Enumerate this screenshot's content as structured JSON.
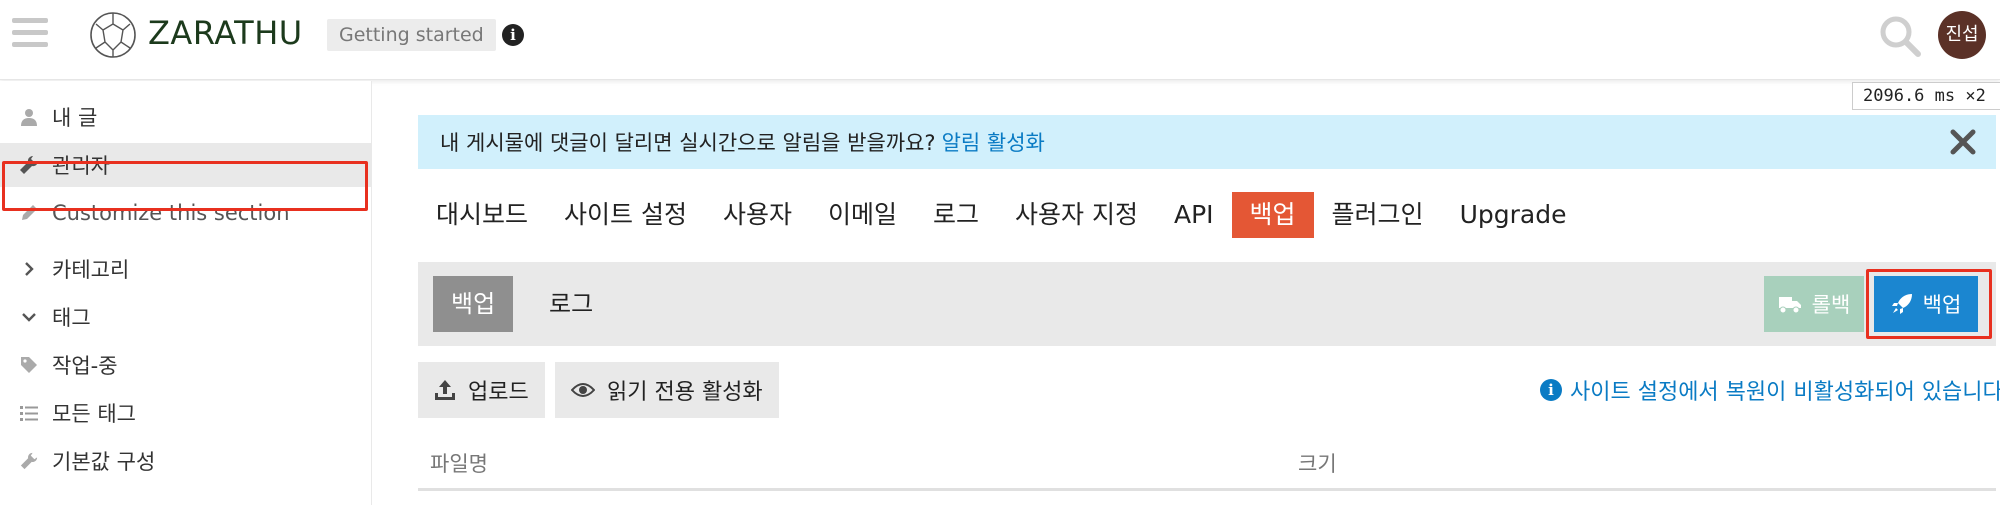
{
  "header": {
    "brand": "ZARATHU",
    "breadcrumb": "Getting started",
    "info_glyph": "i",
    "avatar_text": "진섭",
    "icons": [
      "hamburger-icon",
      "logo-icon",
      "info-icon",
      "search-icon"
    ]
  },
  "sidebar": {
    "items": [
      {
        "label": "내 글",
        "icon": "user-icon"
      },
      {
        "label": "관리자",
        "icon": "wrench-icon"
      },
      {
        "label": "Customize this section",
        "icon": "pencil-icon"
      },
      {
        "label": "카테고리",
        "icon": "chevron-right-icon"
      },
      {
        "label": "태그",
        "icon": "chevron-down-icon"
      },
      {
        "label": "작업-중",
        "icon": "tag-icon"
      },
      {
        "label": "모든 태그",
        "icon": "list-icon"
      },
      {
        "label": "기본값 구성",
        "icon": "wrench-icon"
      }
    ]
  },
  "timing": {
    "value": "2096.6",
    "unit": "ms",
    "mult": "×2"
  },
  "banner": {
    "text": "내 게시물에 댓글이 달리면 실시간으로 알림을 받을까요?",
    "link": "알림 활성화"
  },
  "admin_nav": {
    "tabs": [
      "대시보드",
      "사이트 설정",
      "사용자",
      "이메일",
      "로그",
      "사용자 지정",
      "API",
      "백업",
      "플러그인",
      "Upgrade"
    ],
    "active": "백업"
  },
  "backup": {
    "sub_tabs": [
      "백업",
      "로그"
    ],
    "rollback_label": "롤백",
    "backup_label": "백업",
    "upload_label": "업로드",
    "readonly_label": "읽기 전용 활성화",
    "restore_note": "사이트 설정에서 복원이 비활성화되어 있습니다.",
    "table_headers": [
      "파일명",
      "크기"
    ]
  },
  "colors": {
    "accent": "#e45735",
    "primary_button": "#1b86d0",
    "rollback_button": "#a8d0bc",
    "banner_bg": "#d1f0fc",
    "link": "#0a7bc4",
    "highlight_box": "#e8301f"
  }
}
